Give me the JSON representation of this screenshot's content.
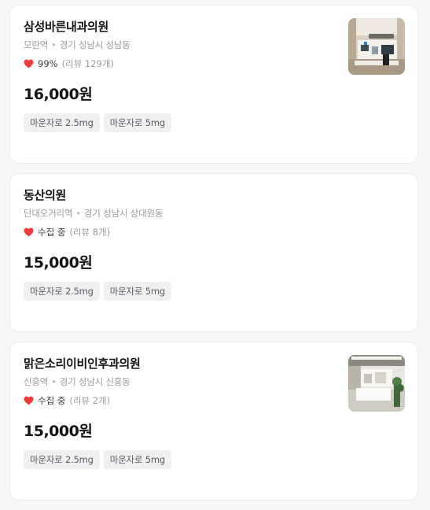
{
  "clinics": [
    {
      "name": "삼성바른내과의원",
      "station": "모란역",
      "address": "경기 성남시 성남동",
      "score": "99%",
      "reviews": "(리뷰 129개)",
      "price": "16,000원",
      "tags": [
        "마운자로 2.5mg",
        "마운자로 5mg"
      ],
      "has_photo": true
    },
    {
      "name": "동산의원",
      "station": "단대오거리역",
      "address": "경기 성남시 상대원동",
      "score": "수집 중",
      "reviews": "(리뷰 8개)",
      "price": "15,000원",
      "tags": [
        "마운자로 2.5mg",
        "마운자로 5mg"
      ],
      "has_photo": false
    },
    {
      "name": "맑은소리이비인후과의원",
      "station": "신흥역",
      "address": "경기 성남시 신흥동",
      "score": "수집 중",
      "reviews": "(리뷰 2개)",
      "price": "15,000원",
      "tags": [
        "마운자로 2.5mg",
        "마운자로 5mg"
      ],
      "has_photo": true
    }
  ],
  "separator": "•",
  "colors": {
    "heart": "#ef3b3b",
    "tag_bg": "#f0f0f2",
    "muted_text": "#9a9aa0"
  },
  "icons": {
    "rating": "heart-icon",
    "photo": "clinic-photo"
  }
}
